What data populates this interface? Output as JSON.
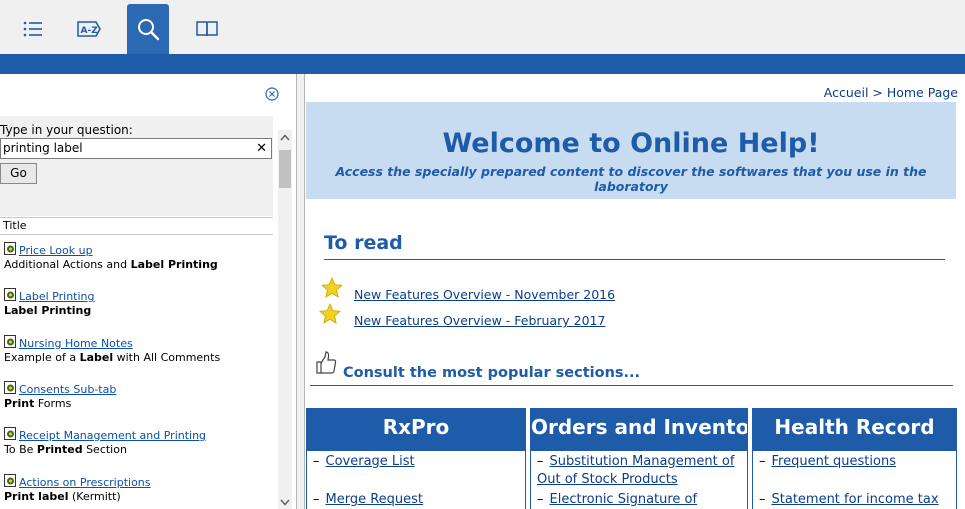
{
  "toolbar": {
    "buttons": [
      {
        "icon": "list-icon"
      },
      {
        "icon": "a-z-index-icon",
        "label": "A-Z"
      },
      {
        "icon": "search-icon",
        "active": true
      },
      {
        "icon": "book-icon"
      }
    ],
    "accent": "#1e5ba8"
  },
  "search": {
    "question_label": "Type in your question:",
    "query_value": "printing label",
    "clear_glyph": "✕",
    "go_label": "Go"
  },
  "results": {
    "column_header": "Title",
    "items": [
      {
        "title": "Price Look up",
        "desc_parts": [
          {
            "t": "Additional Actions and ",
            "b": false
          },
          {
            "t": "Label Printing",
            "b": true
          }
        ]
      },
      {
        "title": "Label Printing",
        "desc_parts": [
          {
            "t": "Label Printing",
            "b": true
          }
        ]
      },
      {
        "title": "Nursing Home Notes",
        "desc_parts": [
          {
            "t": "Example of a ",
            "b": false
          },
          {
            "t": "Label",
            "b": true
          },
          {
            "t": " with All Comments",
            "b": false
          }
        ]
      },
      {
        "title": "Consents Sub-tab",
        "desc_parts": [
          {
            "t": "Print",
            "b": true
          },
          {
            "t": " Forms",
            "b": false
          }
        ]
      },
      {
        "title": "Receipt Management and Printing",
        "desc_parts": [
          {
            "t": "To Be ",
            "b": false
          },
          {
            "t": "Printed",
            "b": true
          },
          {
            "t": " Section",
            "b": false
          }
        ]
      },
      {
        "title": "Actions on Prescriptions",
        "desc_parts": [
          {
            "t": "Print label",
            "b": true
          },
          {
            "t": " (Kermitt)",
            "b": false
          }
        ]
      }
    ]
  },
  "main": {
    "breadcrumb": "Accueil > Home Page",
    "welcome_title": "Welcome to Online Help!",
    "welcome_subtitle": "Access the specially prepared content to discover the softwares that you use in the laboratory",
    "to_read_heading": "To read",
    "to_read_links": [
      "New Features Overview - November 2016",
      "New Features Overview - February 2017"
    ],
    "consult_heading": "Consult the most popular sections...",
    "cards": [
      {
        "title": "RxPro",
        "items": [
          "Coverage List",
          "Merge Request"
        ]
      },
      {
        "title": "Orders and Inventory",
        "items": [
          "Substitution Management of Out of Stock Products",
          "Electronic Signature of"
        ]
      },
      {
        "title": "Health Record",
        "items": [
          "Frequent questions",
          "Statement for income tax"
        ]
      }
    ]
  }
}
